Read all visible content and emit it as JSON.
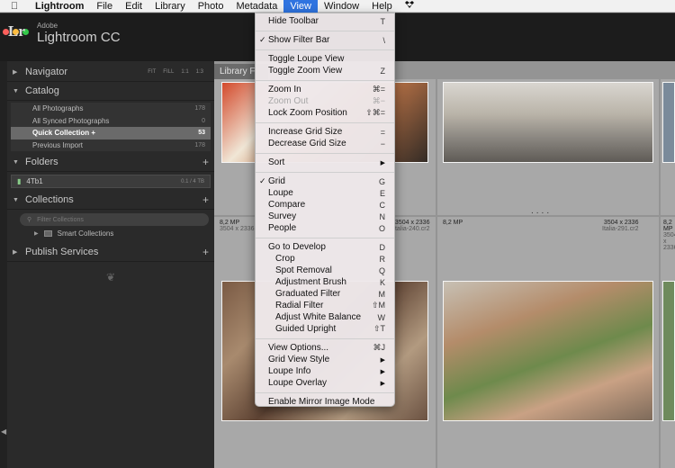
{
  "menubar": {
    "apple_icon": "apple-icon",
    "app_name": "Lightroom",
    "items": [
      "File",
      "Edit",
      "Library",
      "Photo",
      "Metadata",
      "View",
      "Window",
      "Help"
    ],
    "active": "View",
    "extra_icon": "dropbox-icon"
  },
  "brand": {
    "small": "Adobe",
    "big": "Lightroom CC",
    "logo": "Lr"
  },
  "left_panel": {
    "navigator": {
      "title": "Navigator",
      "modes": [
        "FIT",
        "FILL",
        "1:1",
        "1:3"
      ]
    },
    "catalog": {
      "title": "Catalog",
      "rows": [
        {
          "label": "All Photographs",
          "count": "178"
        },
        {
          "label": "All Synced Photographs",
          "count": "0"
        },
        {
          "label": "Quick Collection +",
          "count": "53",
          "selected": true
        },
        {
          "label": "Previous Import",
          "count": "178"
        }
      ]
    },
    "folders": {
      "title": "Folders",
      "volume": "4Tb1",
      "volume_info": "0.1 / 4 TB"
    },
    "collections": {
      "title": "Collections",
      "filter_placeholder": "Filter Collections",
      "smart": "Smart Collections"
    },
    "publish": {
      "title": "Publish Services"
    }
  },
  "grid": {
    "header": "Library F",
    "cells": [
      {
        "dims": "",
        "file": "",
        "mp": ""
      },
      {
        "dims": "",
        "file": "",
        "mp": ""
      },
      {
        "mp": "8,2 MP",
        "dims": "3504 x 2336",
        "file": ""
      },
      {
        "mp": "",
        "dims": "3504 x 2336",
        "file": "Italia-240.cr2"
      },
      {
        "mp": "8,2 MP",
        "dims": "3504 x 2336",
        "file": "Italia-291.cr2"
      },
      {
        "mp": "8,2 MP",
        "dims": "3504 x 2336",
        "file": ""
      }
    ]
  },
  "view_menu": {
    "items": [
      {
        "label": "Hide Toolbar",
        "shortcut": "T"
      },
      {
        "sep": true
      },
      {
        "label": "Show Filter Bar",
        "shortcut": "\\",
        "checked": true
      },
      {
        "sep": true
      },
      {
        "label": "Toggle Loupe View",
        "shortcut": ""
      },
      {
        "label": "Toggle Zoom View",
        "shortcut": "Z"
      },
      {
        "sep": true
      },
      {
        "label": "Zoom In",
        "shortcut": "⌘="
      },
      {
        "label": "Zoom Out",
        "shortcut": "⌘−",
        "disabled": true
      },
      {
        "label": "Lock Zoom Position",
        "shortcut": "⇧⌘="
      },
      {
        "sep": true
      },
      {
        "label": "Increase Grid Size",
        "shortcut": "="
      },
      {
        "label": "Decrease Grid Size",
        "shortcut": "−"
      },
      {
        "sep": true
      },
      {
        "label": "Sort",
        "submenu": true
      },
      {
        "sep": true
      },
      {
        "label": "Grid",
        "shortcut": "G",
        "checked": true
      },
      {
        "label": "Loupe",
        "shortcut": "E"
      },
      {
        "label": "Compare",
        "shortcut": "C"
      },
      {
        "label": "Survey",
        "shortcut": "N"
      },
      {
        "label": "People",
        "shortcut": "O"
      },
      {
        "sep": true
      },
      {
        "label": "Go to Develop",
        "shortcut": "D"
      },
      {
        "label": "Crop",
        "shortcut": "R",
        "indent": true
      },
      {
        "label": "Spot Removal",
        "shortcut": "Q",
        "indent": true
      },
      {
        "label": "Adjustment Brush",
        "shortcut": "K",
        "indent": true
      },
      {
        "label": "Graduated Filter",
        "shortcut": "M",
        "indent": true
      },
      {
        "label": "Radial Filter",
        "shortcut": "⇧M",
        "indent": true
      },
      {
        "label": "Adjust White Balance",
        "shortcut": "W",
        "indent": true
      },
      {
        "label": "Guided Upright",
        "shortcut": "⇧T",
        "indent": true
      },
      {
        "sep": true
      },
      {
        "label": "View Options...",
        "shortcut": "⌘J"
      },
      {
        "label": "Grid View Style",
        "submenu": true
      },
      {
        "label": "Loupe Info",
        "submenu": true
      },
      {
        "label": "Loupe Overlay",
        "submenu": true
      },
      {
        "sep": true
      },
      {
        "label": "Enable Mirror Image Mode",
        "shortcut": ""
      }
    ]
  },
  "colors": {
    "menu_highlight": "#2f74e0",
    "selected_row": "#6a6a6a",
    "close": "#fc605c",
    "minimize": "#fdbc40",
    "zoom": "#34c84a"
  }
}
